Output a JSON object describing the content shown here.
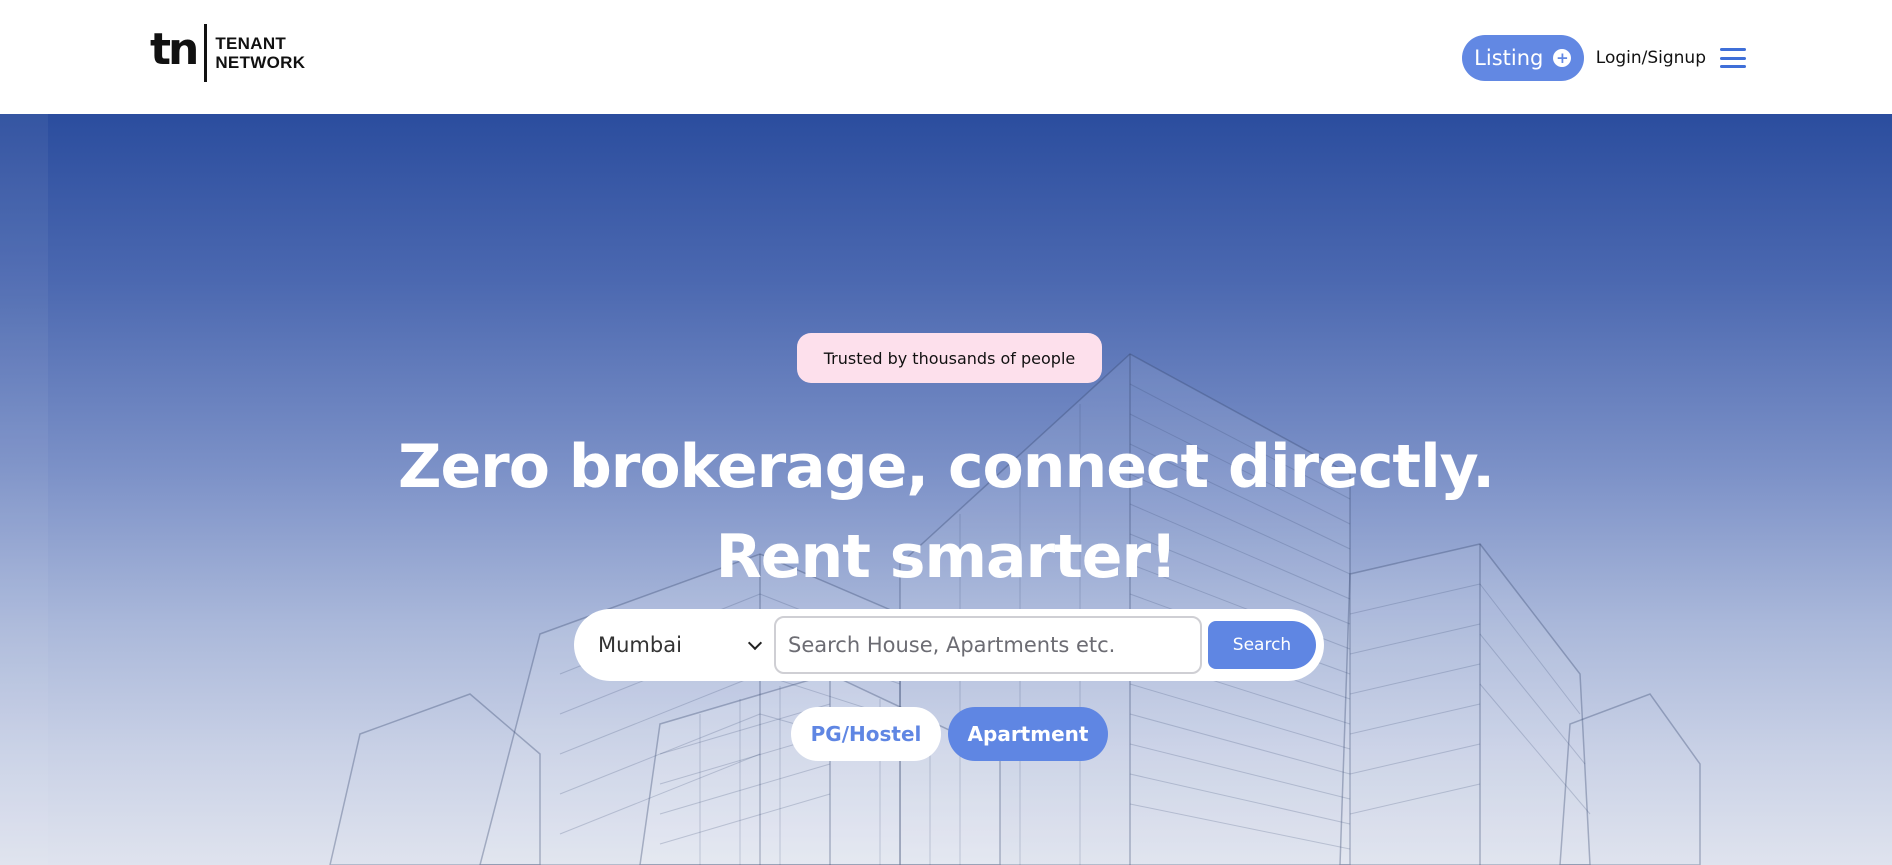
{
  "header": {
    "logo": {
      "mark": "tn",
      "line1": "TENANT",
      "line2": "NETWORK"
    },
    "listing_label": "Listing",
    "plus_symbol": "+",
    "login_label": "Login/Signup",
    "menu_icon": "hamburger-menu-icon"
  },
  "hero": {
    "badge": "Trusted by thousands of people",
    "headline_line1": "Zero brokerage, connect directly.",
    "headline_line2": "Rent smarter!",
    "search": {
      "city_selected": "Mumbai",
      "placeholder": "Search House, Apartments etc.",
      "button_label": "Search"
    },
    "chips": [
      {
        "label": "PG/Hostel",
        "active": false
      },
      {
        "label": "Apartment",
        "active": true
      }
    ]
  },
  "colors": {
    "accent": "#5f86e3",
    "badge_bg": "#fde0ec",
    "hero_top": "#2b4d9e",
    "hero_bottom": "#dfe3ee"
  }
}
